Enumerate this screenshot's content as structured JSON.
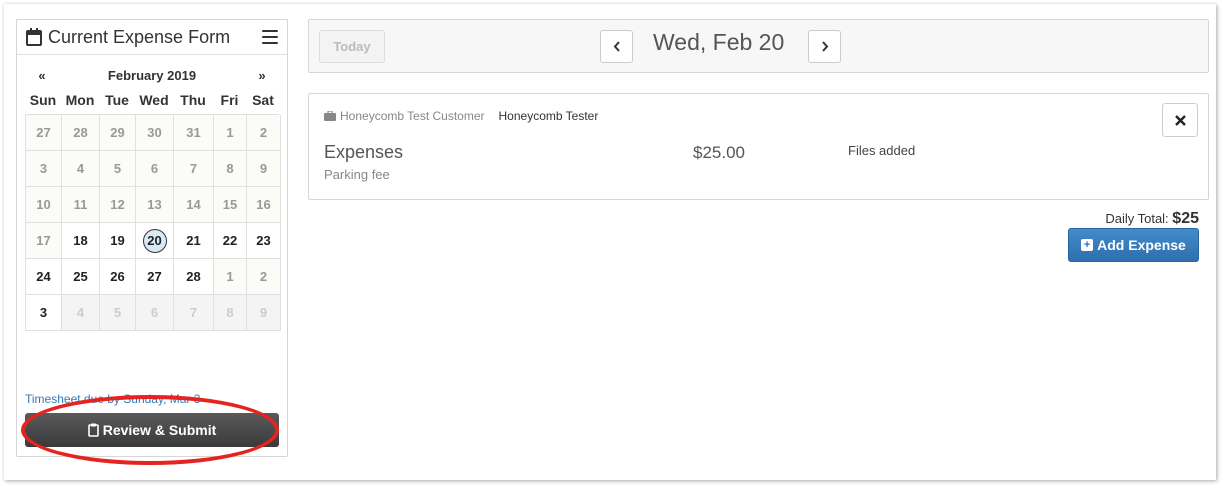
{
  "sidebar": {
    "title": "Current Expense Form",
    "calendar": {
      "prev_label": "«",
      "month_label": "February 2019",
      "next_label": "»",
      "weekdays": [
        "Sun",
        "Mon",
        "Tue",
        "Wed",
        "Thu",
        "Fri",
        "Sat"
      ],
      "days": [
        [
          "27",
          "28",
          "29",
          "30",
          "31",
          "1",
          "2"
        ],
        [
          "3",
          "4",
          "5",
          "6",
          "7",
          "8",
          "9"
        ],
        [
          "10",
          "11",
          "12",
          "13",
          "14",
          "15",
          "16"
        ],
        [
          "17",
          "18",
          "19",
          "20",
          "21",
          "22",
          "23"
        ],
        [
          "24",
          "25",
          "26",
          "27",
          "28",
          "1",
          "2"
        ],
        [
          "3",
          "4",
          "5",
          "6",
          "7",
          "8",
          "9"
        ]
      ],
      "selected_day": "20"
    },
    "timesheet_note": "Timesheet due by Sunday, Mar 3",
    "review_button_label": "Review & Submit"
  },
  "topbar": {
    "today_label": "Today",
    "prev_icon": "chevron-left-icon",
    "next_icon": "chevron-right-icon",
    "date_title": "Wed, Feb 20"
  },
  "entry": {
    "customer": "Honeycomb Test Customer",
    "project": "Honeycomb Tester",
    "category": "Expenses",
    "description": "Parking fee",
    "amount": "$25.00",
    "files_note": "Files added"
  },
  "daily_total": {
    "label": "Daily Total:",
    "value": "$25"
  },
  "add_expense_label": "Add Expense",
  "colors": {
    "highlight": "#e52420",
    "primary": "#428bca",
    "dark_button": "#444444"
  }
}
